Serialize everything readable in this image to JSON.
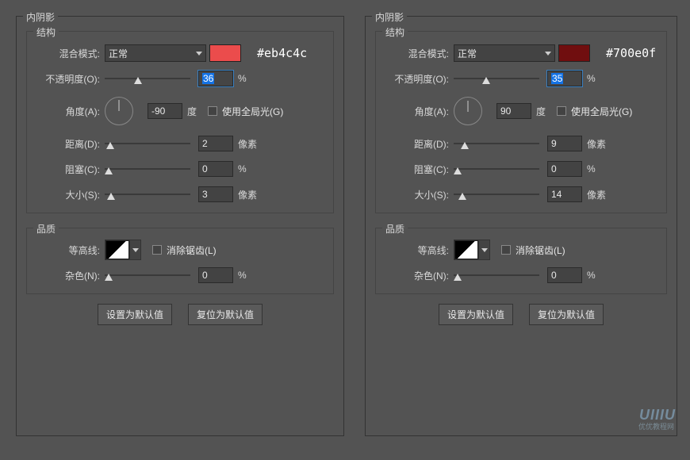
{
  "left": {
    "title": "内阴影",
    "hex": "#eb4c4c",
    "swatch": "#eb4c4c",
    "structure": {
      "title": "结构",
      "blend_label": "混合模式:",
      "blend_value": "正常",
      "opacity_label": "不透明度(O):",
      "opacity_value": "36",
      "opacity_unit": "%",
      "angle_label": "角度(A):",
      "angle_value": "-90",
      "angle_unit": "度",
      "global_light": "使用全局光(G)",
      "distance_label": "距离(D):",
      "distance_value": "2",
      "distance_unit": "像素",
      "choke_label": "阻塞(C):",
      "choke_value": "0",
      "choke_unit": "%",
      "size_label": "大小(S):",
      "size_value": "3",
      "size_unit": "像素"
    },
    "quality": {
      "title": "品质",
      "contour_label": "等高线:",
      "antialias": "消除锯齿(L)",
      "noise_label": "杂色(N):",
      "noise_value": "0",
      "noise_unit": "%"
    },
    "btn_default": "设置为默认值",
    "btn_reset": "复位为默认值"
  },
  "right": {
    "title": "内阴影",
    "hex": "#700e0f",
    "swatch": "#700e0f",
    "structure": {
      "title": "结构",
      "blend_label": "混合模式:",
      "blend_value": "正常",
      "opacity_label": "不透明度(O):",
      "opacity_value": "35",
      "opacity_unit": "%",
      "angle_label": "角度(A):",
      "angle_value": "90",
      "angle_unit": "度",
      "global_light": "使用全局光(G)",
      "distance_label": "距离(D):",
      "distance_value": "9",
      "distance_unit": "像素",
      "choke_label": "阻塞(C):",
      "choke_value": "0",
      "choke_unit": "%",
      "size_label": "大小(S):",
      "size_value": "14",
      "size_unit": "像素"
    },
    "quality": {
      "title": "品质",
      "contour_label": "等高线:",
      "antialias": "消除锯齿(L)",
      "noise_label": "杂色(N):",
      "noise_value": "0",
      "noise_unit": "%"
    },
    "btn_default": "设置为默认值",
    "btn_reset": "复位为默认值"
  },
  "watermark": "UIIIU",
  "watermark_sub": "优优教程网"
}
